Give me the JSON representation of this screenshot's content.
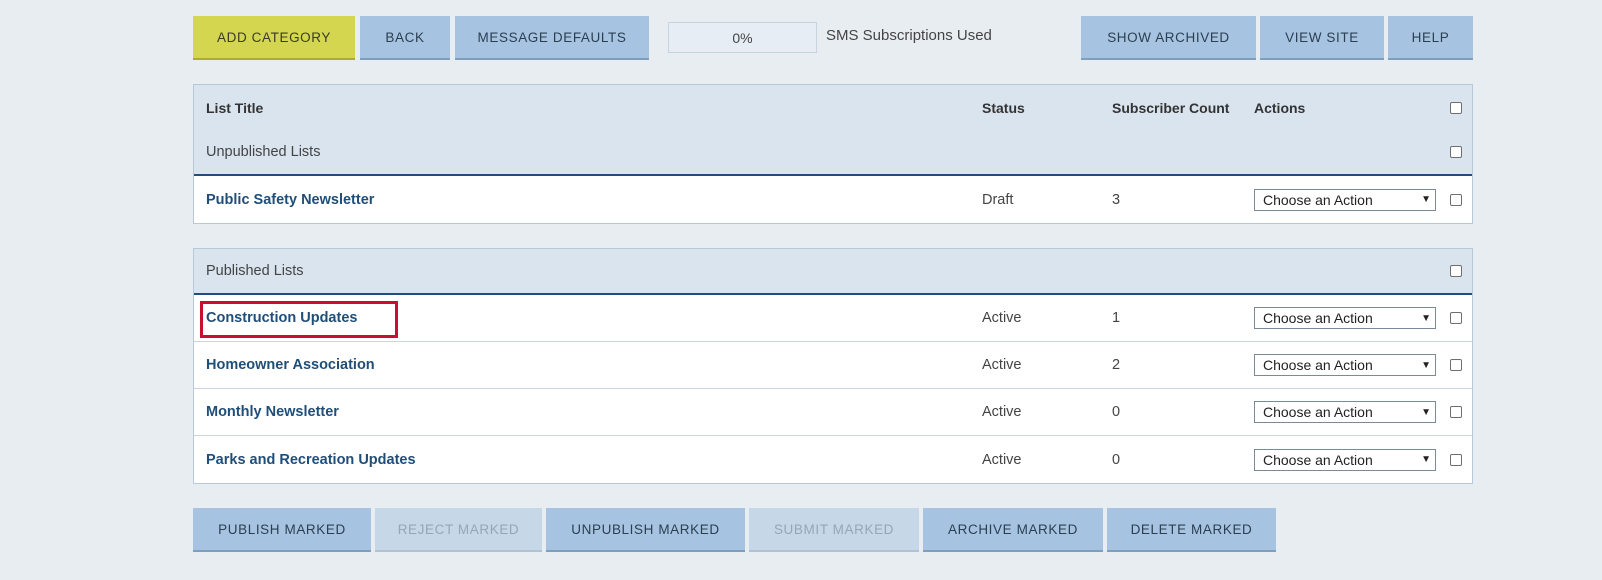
{
  "toolbar": {
    "add_category": "ADD CATEGORY",
    "back": "BACK",
    "message_defaults": "MESSAGE DEFAULTS",
    "sms_percent": "0%",
    "sms_label": "SMS Subscriptions Used",
    "show_archived": "SHOW ARCHIVED",
    "view_site": "VIEW SITE",
    "help": "HELP"
  },
  "table": {
    "headers": {
      "title": "List Title",
      "status": "Status",
      "count": "Subscriber Count",
      "actions": "Actions"
    },
    "unpublished_label": "Unpublished Lists",
    "published_label": "Published Lists",
    "action_placeholder": "Choose an Action",
    "unpublished": [
      {
        "title": "Public Safety Newsletter",
        "status": "Draft",
        "count": "3"
      }
    ],
    "published": [
      {
        "title": "Construction Updates",
        "status": "Active",
        "count": "1"
      },
      {
        "title": "Homeowner Association",
        "status": "Active",
        "count": "2"
      },
      {
        "title": "Monthly Newsletter",
        "status": "Active",
        "count": "0"
      },
      {
        "title": "Parks and Recreation Updates",
        "status": "Active",
        "count": "0"
      }
    ]
  },
  "bottom": {
    "publish": "PUBLISH MARKED",
    "reject": "REJECT MARKED",
    "unpublish": "UNPUBLISH MARKED",
    "submit": "SUBMIT MARKED",
    "archive": "ARCHIVE MARKED",
    "delete": "DELETE MARKED"
  }
}
